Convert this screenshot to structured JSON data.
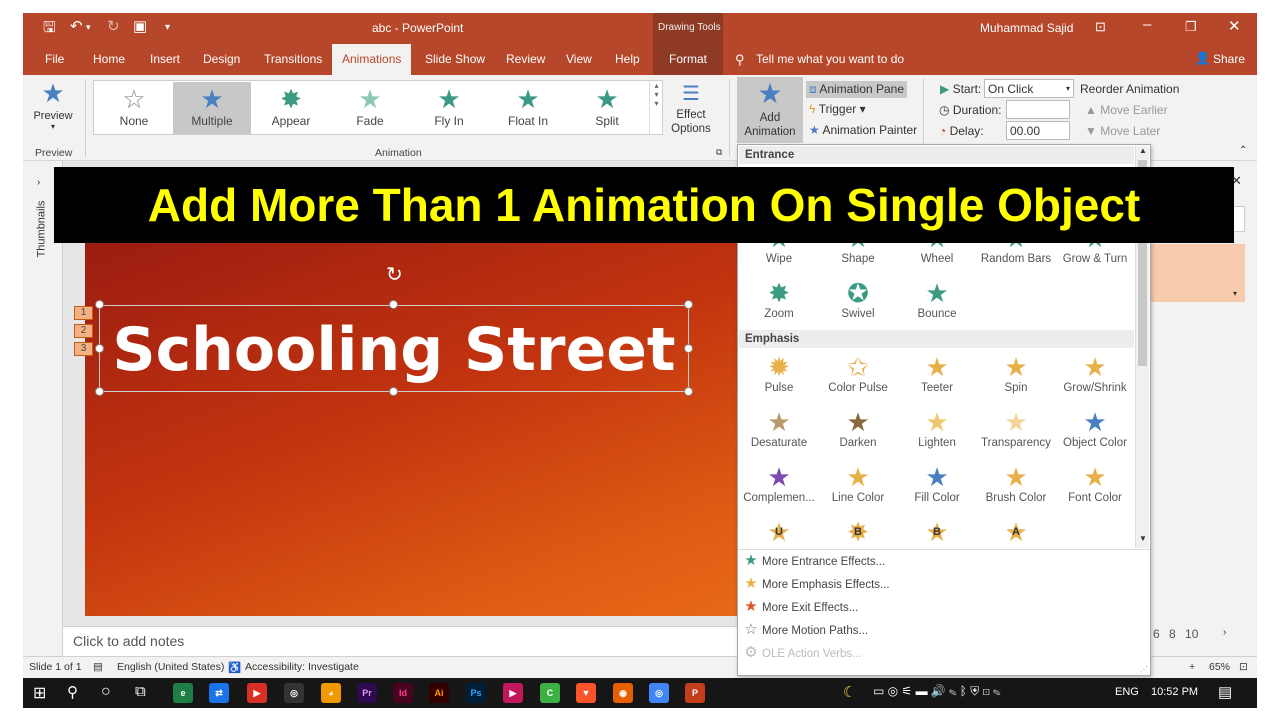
{
  "titlebar": {
    "doc_title": "abc  -  PowerPoint",
    "context_group": "Drawing Tools",
    "user": "Muhammad Sajid"
  },
  "tabs": [
    "File",
    "Home",
    "Insert",
    "Design",
    "Transitions",
    "Animations",
    "Slide Show",
    "Review",
    "View",
    "Help"
  ],
  "format_tab": "Format",
  "tellme": "Tell me what you want to do",
  "share": "Share",
  "ribbon": {
    "preview_label": "Preview",
    "preview_group": "Preview",
    "gallery": [
      {
        "label": "None",
        "icon": "☆",
        "color": "#8a8a8a"
      },
      {
        "label": "Multiple",
        "icon": "★",
        "color": "#4a7fc1"
      },
      {
        "label": "Appear",
        "icon": "✸",
        "color": "#3c9a83"
      },
      {
        "label": "Fade",
        "icon": "★",
        "color": "#8fc9b6"
      },
      {
        "label": "Fly In",
        "icon": "★",
        "color": "#3c9a83"
      },
      {
        "label": "Float In",
        "icon": "★",
        "color": "#3c9a83"
      },
      {
        "label": "Split",
        "icon": "★",
        "color": "#3c9a83"
      }
    ],
    "animation_group": "Animation",
    "effect_options": "Effect Options",
    "add_animation": "Add Animation",
    "animation_pane": "Animation Pane",
    "trigger": "Trigger",
    "animation_painter": "Animation Painter",
    "start_label": "Start:",
    "start_value": "On Click",
    "duration_label": "Duration:",
    "delay_label": "Delay:",
    "delay_value": "00.00",
    "reorder": "Reorder Animation",
    "move_earlier": "Move Earlier",
    "move_later": "Move Later"
  },
  "thumbnails_label": "Thumbnails",
  "slide": {
    "title": "Schooling Street",
    "tags": [
      "1",
      "2",
      "3"
    ]
  },
  "banner": "Add More Than 1 Animation On Single Object",
  "notes_placeholder": "Click to add notes",
  "dropdown": {
    "entrance_header": "Entrance",
    "entrance": [
      {
        "label": "Wipe",
        "icon": "★",
        "color": "#3c9a83"
      },
      {
        "label": "Shape",
        "icon": "★",
        "color": "#3c9a83"
      },
      {
        "label": "Wheel",
        "icon": "★",
        "color": "#3c9a83"
      },
      {
        "label": "Random Bars",
        "icon": "★",
        "color": "#3c9a83"
      },
      {
        "label": "Grow & Turn",
        "icon": "★",
        "color": "#3c9a83"
      },
      {
        "label": "Zoom",
        "icon": "✸",
        "color": "#3c9a83"
      },
      {
        "label": "Swivel",
        "icon": "✪",
        "color": "#3c9a83"
      },
      {
        "label": "Bounce",
        "icon": "★",
        "color": "#3c9a83"
      }
    ],
    "emphasis_header": "Emphasis",
    "emphasis": [
      {
        "label": "Pulse",
        "icon": "✹",
        "color": "#e8b04a"
      },
      {
        "label": "Color Pulse",
        "icon": "✩",
        "color": "#e8b04a"
      },
      {
        "label": "Teeter",
        "icon": "★",
        "color": "#e8b04a"
      },
      {
        "label": "Spin",
        "icon": "★",
        "color": "#e8b04a"
      },
      {
        "label": "Grow/Shrink",
        "icon": "★",
        "color": "#e8b04a"
      },
      {
        "label": "Desaturate",
        "icon": "★",
        "color": "#b89a6a"
      },
      {
        "label": "Darken",
        "icon": "★",
        "color": "#8a6a3a"
      },
      {
        "label": "Lighten",
        "icon": "★",
        "color": "#f0c870"
      },
      {
        "label": "Transparency",
        "icon": "★",
        "color": "#f4d49a"
      },
      {
        "label": "Object Color",
        "icon": "★",
        "color": "#4a7fc1"
      },
      {
        "label": "Complemen...",
        "icon": "★",
        "color": "#7a4ab0"
      },
      {
        "label": "Line Color",
        "icon": "★",
        "color": "#e8b04a"
      },
      {
        "label": "Fill Color",
        "icon": "★",
        "color": "#4a7fc1"
      },
      {
        "label": "Brush Color",
        "icon": "★",
        "color": "#e8b04a"
      },
      {
        "label": "Font Color",
        "icon": "★",
        "color": "#e8b04a"
      },
      {
        "label": "",
        "icon": "★",
        "color": "#e8b04a",
        "letter": "U"
      },
      {
        "label": "",
        "icon": "✸",
        "color": "#e8b04a",
        "letter": "B"
      },
      {
        "label": "",
        "icon": "★",
        "color": "#e8b04a",
        "letter": "B"
      },
      {
        "label": "",
        "icon": "★",
        "color": "#e8b04a",
        "letter": "A"
      }
    ],
    "more": [
      {
        "label": "More Entrance Effects...",
        "icon": "★",
        "color": "#3c9a83",
        "disabled": false
      },
      {
        "label": "More Emphasis Effects...",
        "icon": "★",
        "color": "#e8b04a",
        "disabled": false
      },
      {
        "label": "More Exit Effects...",
        "icon": "★",
        "color": "#d9542c",
        "disabled": false
      },
      {
        "label": "More Motion Paths...",
        "icon": "☆",
        "color": "#777777",
        "disabled": false
      },
      {
        "label": "OLE Action Verbs...",
        "icon": "⚙",
        "color": "#bbbbbb",
        "disabled": true
      }
    ]
  },
  "zoom_ticks": "6   8   10",
  "statusbar": {
    "slide": "Slide 1 of 1",
    "language": "English (United States)",
    "accessibility": "Accessibility: Investigate",
    "zoom": "65%"
  },
  "taskbar": {
    "lang": "ENG",
    "time": "10:52 PM"
  }
}
